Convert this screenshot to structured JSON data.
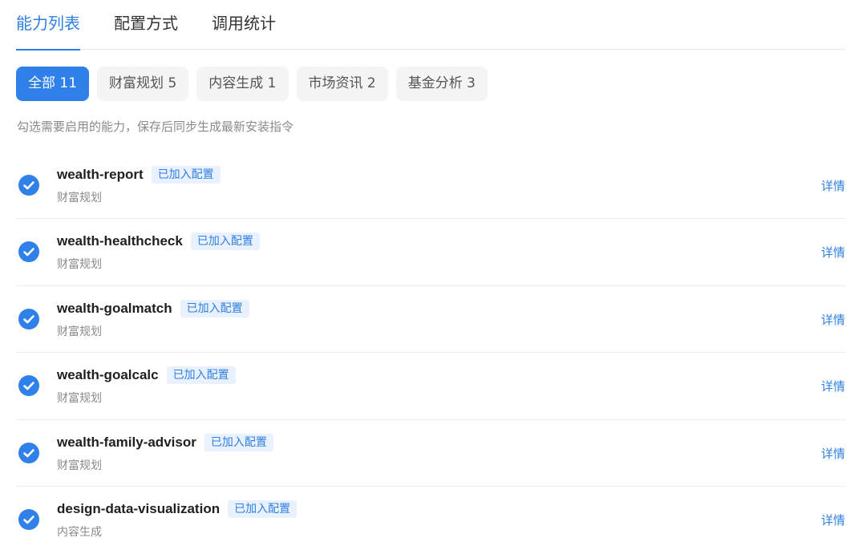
{
  "tabs": [
    {
      "label": "能力列表",
      "active": true
    },
    {
      "label": "配置方式",
      "active": false
    },
    {
      "label": "调用统计",
      "active": false
    }
  ],
  "filters": [
    {
      "label": "全部 11",
      "active": true
    },
    {
      "label": "财富规划 5",
      "active": false
    },
    {
      "label": "内容生成 1",
      "active": false
    },
    {
      "label": "市场资讯 2",
      "active": false
    },
    {
      "label": "基金分析 3",
      "active": false
    }
  ],
  "hint": "勾选需要启用的能力，保存后同步生成最新安装指令",
  "items": [
    {
      "name": "wealth-report",
      "badge": "已加入配置",
      "category": "财富规划",
      "detail": "详情",
      "checked": true
    },
    {
      "name": "wealth-healthcheck",
      "badge": "已加入配置",
      "category": "财富规划",
      "detail": "详情",
      "checked": true
    },
    {
      "name": "wealth-goalmatch",
      "badge": "已加入配置",
      "category": "财富规划",
      "detail": "详情",
      "checked": true
    },
    {
      "name": "wealth-goalcalc",
      "badge": "已加入配置",
      "category": "财富规划",
      "detail": "详情",
      "checked": true
    },
    {
      "name": "wealth-family-advisor",
      "badge": "已加入配置",
      "category": "财富规划",
      "detail": "详情",
      "checked": true
    },
    {
      "name": "design-data-visualization",
      "badge": "已加入配置",
      "category": "内容生成",
      "detail": "详情",
      "checked": true
    }
  ],
  "colors": {
    "accent": "#2f80e8",
    "badge_bg": "#e8f1fd",
    "chip_bg": "#f4f4f5"
  },
  "icons": {
    "checked": "check-circle-icon"
  }
}
